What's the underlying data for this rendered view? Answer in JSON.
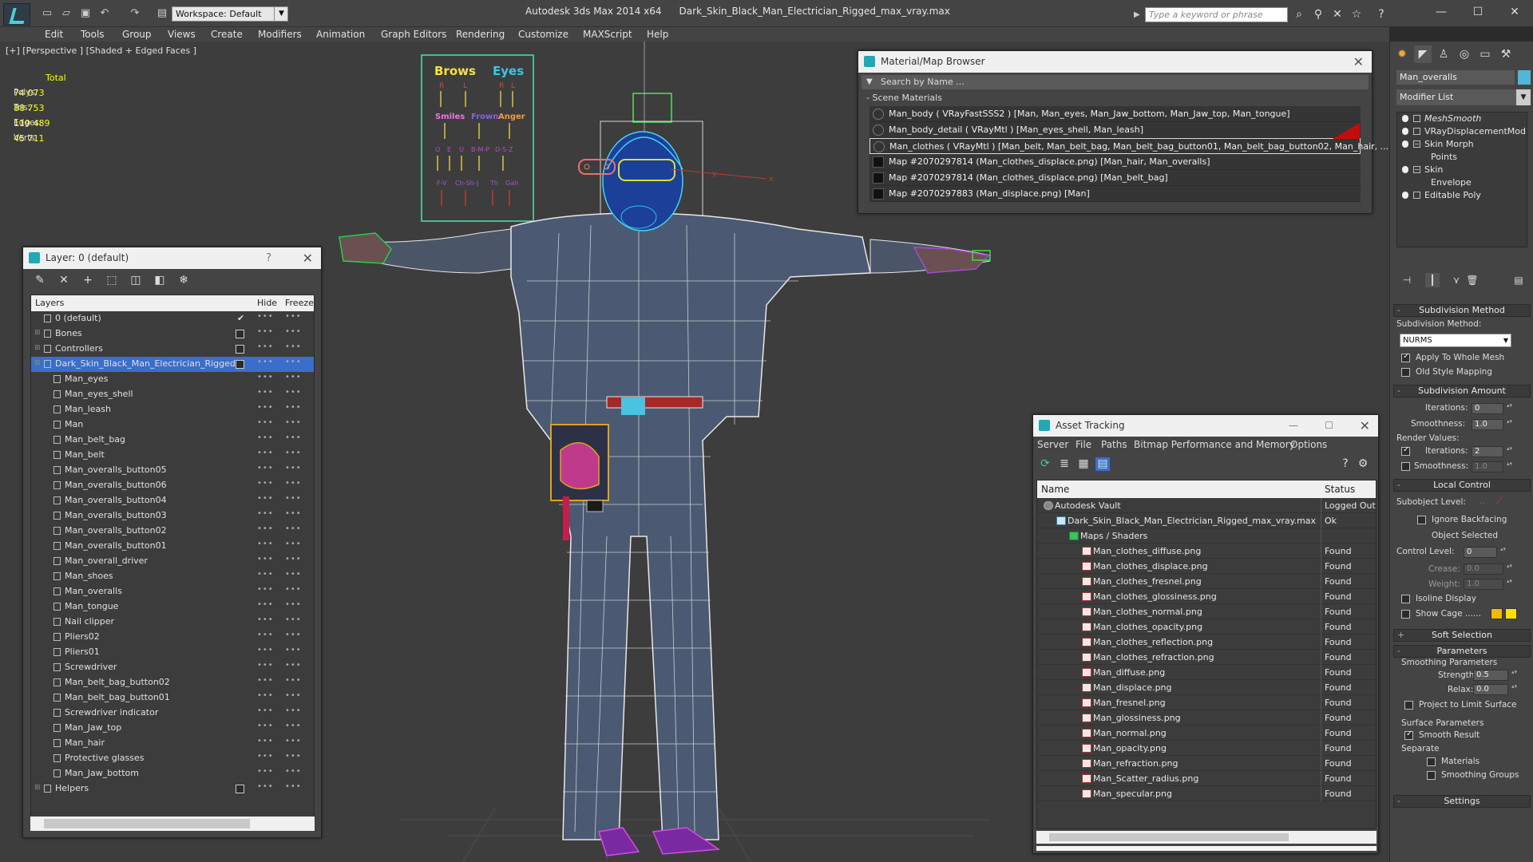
{
  "titlebar": {
    "app_name": "Autodesk 3ds Max  2014 x64",
    "file_name": "Dark_Skin_Black_Man_Electrician_Rigged_max_vray.max",
    "workspace": "Workspace: Default",
    "search_placeholder": "Type a keyword or phrase"
  },
  "menu": [
    "Edit",
    "Tools",
    "Group",
    "Views",
    "Create",
    "Modifiers",
    "Animation",
    "Graph Editors",
    "Rendering",
    "Customize",
    "MAXScript",
    "Help"
  ],
  "viewport": {
    "label": "[+] [Perspective ] [Shaded + Edged Faces ]",
    "stats_header": "Total",
    "stats": [
      {
        "label": "Polys:",
        "value": "74 073"
      },
      {
        "label": "Tris:",
        "value": "88 753"
      },
      {
        "label": "Edges:",
        "value": "119 489"
      },
      {
        "label": "Verts:",
        "value": "45 711"
      }
    ],
    "face_ui": {
      "brows": "Brows",
      "eyes": "Eyes",
      "r1": "R",
      "l1": "L",
      "r2": "R",
      "l2": "L",
      "smiles": "Smiles",
      "frown": "Frown",
      "anger": "Anger",
      "phonemes": [
        "O",
        "E",
        "U",
        "B-M-P",
        "D-S-Z"
      ],
      "bottom": [
        "F-V",
        "Ch-Sh-J",
        "Th",
        "Gah"
      ]
    },
    "axis_x": "x",
    "axis_y": "y"
  },
  "layer_dialog": {
    "title": "Layer: 0 (default)",
    "col_layers": "Layers",
    "col_hide": "Hide",
    "col_freeze": "Freeze",
    "rows": [
      {
        "name": "0 (default)",
        "level": 0,
        "type": "layer",
        "checked": true
      },
      {
        "name": "Bones",
        "level": 0,
        "type": "layer",
        "expand": true,
        "hidebox": true
      },
      {
        "name": "Controllers",
        "level": 0,
        "type": "layer",
        "expand": true,
        "hidebox": true
      },
      {
        "name": "Dark_Skin_Black_Man_Electrician_Rigged",
        "level": 0,
        "type": "layer",
        "expand": true,
        "hidebox": true,
        "selected": true
      },
      {
        "name": "Man_eyes",
        "level": 1
      },
      {
        "name": "Man_eyes_shell",
        "level": 1
      },
      {
        "name": "Man_leash",
        "level": 1
      },
      {
        "name": "Man",
        "level": 1
      },
      {
        "name": "Man_belt_bag",
        "level": 1
      },
      {
        "name": "Man_belt",
        "level": 1
      },
      {
        "name": "Man_overalls_button05",
        "level": 1
      },
      {
        "name": "Man_overalls_button06",
        "level": 1
      },
      {
        "name": "Man_overalls_button04",
        "level": 1
      },
      {
        "name": "Man_overalls_button03",
        "level": 1
      },
      {
        "name": "Man_overalls_button02",
        "level": 1
      },
      {
        "name": "Man_overalls_button01",
        "level": 1
      },
      {
        "name": "Man_overall_driver",
        "level": 1
      },
      {
        "name": "Man_shoes",
        "level": 1
      },
      {
        "name": "Man_overalls",
        "level": 1
      },
      {
        "name": "Man_tongue",
        "level": 1
      },
      {
        "name": "Nail clipper",
        "level": 1
      },
      {
        "name": "Pliers02",
        "level": 1
      },
      {
        "name": "Pliers01",
        "level": 1
      },
      {
        "name": "Screwdriver",
        "level": 1
      },
      {
        "name": "Man_belt_bag_button02",
        "level": 1
      },
      {
        "name": "Man_belt_bag_button01",
        "level": 1
      },
      {
        "name": "Screwdriver indicator",
        "level": 1
      },
      {
        "name": "Man_Jaw_top",
        "level": 1
      },
      {
        "name": "Man_hair",
        "level": 1
      },
      {
        "name": "Protective glasses",
        "level": 1
      },
      {
        "name": "Man_Jaw_bottom",
        "level": 1
      },
      {
        "name": "Helpers",
        "level": 0,
        "type": "layer",
        "expand": true,
        "hidebox": true
      }
    ]
  },
  "material_browser": {
    "title": "Material/Map Browser",
    "search_placeholder": "Search by Name ...",
    "group": "Scene Materials",
    "rows": [
      {
        "text": "Man_body  ( VRayFastSSS2 )  [Man, Man_eyes, Man_Jaw_bottom, Man_Jaw_top, Man_tongue]",
        "kind": "mat"
      },
      {
        "text": "Man_body_detail  ( VRayMtl )  [Man_eyes_shell, Man_leash]",
        "kind": "mat"
      },
      {
        "text": "Man_clothes  ( VRayMtl )  [Man_belt, Man_belt_bag, Man_belt_bag_button01, Man_belt_bag_button02, Man_hair, ...",
        "kind": "mat",
        "selected": true
      },
      {
        "text": "Map #2070297814 (Man_clothes_displace.png)  [Man_hair, Man_overalls]",
        "kind": "map"
      },
      {
        "text": "Map #2070297814 (Man_clothes_displace.png)  [Man_belt_bag]",
        "kind": "map"
      },
      {
        "text": "Map #2070297883 (Man_displace.png)  [Man]",
        "kind": "map"
      }
    ]
  },
  "asset_tracking": {
    "title": "Asset Tracking",
    "menu": [
      "Server",
      "File",
      "Paths",
      "Bitmap Performance and Memory",
      "Options"
    ],
    "col_name": "Name",
    "col_status": "Status",
    "rows": [
      {
        "name": "Autodesk Vault",
        "status": "Logged Out",
        "level": 0
      },
      {
        "name": "Dark_Skin_Black_Man_Electrician_Rigged_max_vray.max",
        "status": "Ok",
        "level": 1
      },
      {
        "name": "Maps / Shaders",
        "status": "",
        "level": 2
      },
      {
        "name": "Man_clothes_diffuse.png",
        "status": "Found",
        "level": 3
      },
      {
        "name": "Man_clothes_displace.png",
        "status": "Found",
        "level": 3
      },
      {
        "name": "Man_clothes_fresnel.png",
        "status": "Found",
        "level": 3
      },
      {
        "name": "Man_clothes_glossiness.png",
        "status": "Found",
        "level": 3
      },
      {
        "name": "Man_clothes_normal.png",
        "status": "Found",
        "level": 3
      },
      {
        "name": "Man_clothes_opacity.png",
        "status": "Found",
        "level": 3
      },
      {
        "name": "Man_clothes_reflection.png",
        "status": "Found",
        "level": 3
      },
      {
        "name": "Man_clothes_refraction.png",
        "status": "Found",
        "level": 3
      },
      {
        "name": "Man_diffuse.png",
        "status": "Found",
        "level": 3
      },
      {
        "name": "Man_displace.png",
        "status": "Found",
        "level": 3
      },
      {
        "name": "Man_fresnel.png",
        "status": "Found",
        "level": 3
      },
      {
        "name": "Man_glossiness.png",
        "status": "Found",
        "level": 3
      },
      {
        "name": "Man_normal.png",
        "status": "Found",
        "level": 3
      },
      {
        "name": "Man_opacity.png",
        "status": "Found",
        "level": 3
      },
      {
        "name": "Man_refraction.png",
        "status": "Found",
        "level": 3
      },
      {
        "name": "Man_Scatter_radius.png",
        "status": "Found",
        "level": 3
      },
      {
        "name": "Man_specular.png",
        "status": "Found",
        "level": 3
      }
    ]
  },
  "command_panel": {
    "object_name": "Man_overalls",
    "modifier_list": "Modifier List",
    "stack": [
      {
        "name": "MeshSmooth",
        "level": 0,
        "italic": true
      },
      {
        "name": "VRayDisplacementMod",
        "level": 0
      },
      {
        "name": "Skin Morph",
        "level": 0,
        "expand": true
      },
      {
        "name": "Points",
        "level": 1
      },
      {
        "name": "Skin",
        "level": 0,
        "expand": true
      },
      {
        "name": "Envelope",
        "level": 1
      },
      {
        "name": "Editable Poly",
        "level": 0
      }
    ],
    "subdivision_method_title": "Subdivision Method",
    "subdivision_method_label": "Subdivision Method:",
    "subdivision_method_value": "NURMS",
    "apply_whole_mesh": "Apply To Whole Mesh",
    "old_style_mapping": "Old Style Mapping",
    "subdivision_amount_title": "Subdivision Amount",
    "iterations_label": "Iterations:",
    "iterations_value": "0",
    "smoothness_label": "Smoothness:",
    "smoothness_value": "1.0",
    "render_values": "Render Values:",
    "render_iterations_label": "Iterations:",
    "render_iterations_value": "2",
    "render_smoothness_label": "Smoothness:",
    "render_smoothness_value": "1.0",
    "local_control_title": "Local Control",
    "subobject_level": "Subobject Level:",
    "ignore_backfacing": "Ignore Backfacing",
    "object_selected": "Object Selected",
    "control_level_label": "Control Level:",
    "control_level_value": "0",
    "crease_label": "Crease:",
    "crease_value": "0.0",
    "weight_label": "Weight:",
    "weight_value": "1.0",
    "isoline_display": "Isoline Display",
    "show_cage": "Show Cage ......",
    "cage_color_1": "#f5b800",
    "cage_color_2": "#ffe100",
    "soft_selection_title": "Soft Selection",
    "parameters_title": "Parameters",
    "smoothing_parameters": "Smoothing Parameters",
    "strength_label": "Strength:",
    "strength_value": "0.5",
    "relax_label": "Relax:",
    "relax_value": "0.0",
    "project_limit": "Project to Limit Surface",
    "surface_parameters": "Surface Parameters",
    "smooth_result": "Smooth Result",
    "separate": "Separate",
    "materials": "Materials",
    "smoothing_groups": "Smoothing Groups",
    "settings_title": "Settings"
  }
}
